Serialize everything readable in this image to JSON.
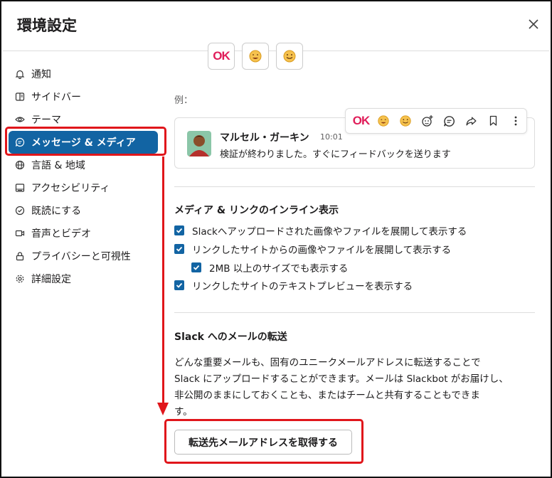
{
  "header": {
    "title": "環境設定",
    "close_icon": "×"
  },
  "sidebar": {
    "items": [
      {
        "label": "通知",
        "icon": "bell-icon"
      },
      {
        "label": "サイドバー",
        "icon": "sidebar-icon"
      },
      {
        "label": "テーマ",
        "icon": "eye-icon"
      },
      {
        "label": "メッセージ & メディア",
        "icon": "message-icon",
        "active": true
      },
      {
        "label": "言語 & 地域",
        "icon": "globe-icon"
      },
      {
        "label": "アクセシビリティ",
        "icon": "keyboard-icon"
      },
      {
        "label": "既読にする",
        "icon": "check-circle-icon"
      },
      {
        "label": "音声とビデオ",
        "icon": "video-icon"
      },
      {
        "label": "プライバシーと可視性",
        "icon": "lock-icon"
      },
      {
        "label": "詳細設定",
        "icon": "gear-icon"
      }
    ]
  },
  "emoji_options": {
    "ok_text": "OK"
  },
  "example": {
    "label": "例：",
    "author": "マルセル・ガーキン",
    "time": "10:01",
    "message": "検証が終わりました。すぐにフィードバックを送ります",
    "hover_ok_text": "OK"
  },
  "inline_media": {
    "title": "メディア & リンクのインライン表示",
    "options": [
      {
        "label": "Slackへアップロードされた画像やファイルを展開して表示する",
        "checked": true
      },
      {
        "label": "リンクしたサイトからの画像やファイルを展開して表示する",
        "checked": true
      },
      {
        "label": "2MB 以上のサイズでも表示する",
        "checked": true
      },
      {
        "label": "リンクしたサイトのテキストプレビューを表示する",
        "checked": true
      }
    ]
  },
  "email_forward": {
    "title": "Slack へのメールの転送",
    "lines": [
      "どんな重要メールも、固有のユニークメールアドレスに転送することで",
      "Slack にアップロードすることができます。メールは Slackbot がお届けし、",
      "非公開のままにしておくことも、またはチームと共有することもできま",
      "す。"
    ],
    "button": "転送先メールアドレスを取得する"
  },
  "colors": {
    "accent": "#1264a3",
    "highlight": "#e0161b",
    "ok_red": "#e01e5a"
  }
}
